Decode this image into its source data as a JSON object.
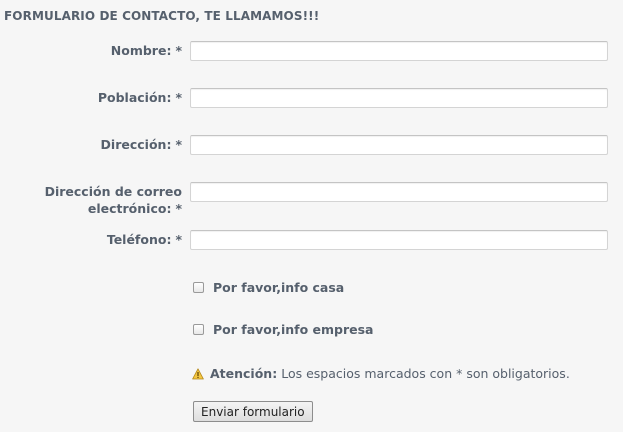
{
  "form": {
    "title": "FORMULARIO DE CONTACTO, TE LLAMAMOS!!!",
    "required_marker": "*",
    "fields": {
      "nombre": {
        "label": "Nombre:",
        "value": "",
        "placeholder": ""
      },
      "poblacion": {
        "label": "Población:",
        "value": "",
        "placeholder": ""
      },
      "direccion": {
        "label": "Dirección:",
        "value": "",
        "placeholder": ""
      },
      "email": {
        "label": "Dirección de correo electrónico:",
        "label_line1": "Dirección de correo",
        "label_line2": "electrónico:",
        "value": "",
        "placeholder": ""
      },
      "telefono": {
        "label": "Teléfono:",
        "value": "",
        "placeholder": ""
      }
    },
    "checkboxes": [
      {
        "label": "Por favor,info casa",
        "checked": false
      },
      {
        "label": "Por favor,info empresa",
        "checked": false
      }
    ],
    "notice": {
      "icon": "warning-icon",
      "strong": "Atención:",
      "text": "Los espacios marcados con * son obligatorios."
    },
    "submit_label": "Enviar formulario"
  }
}
